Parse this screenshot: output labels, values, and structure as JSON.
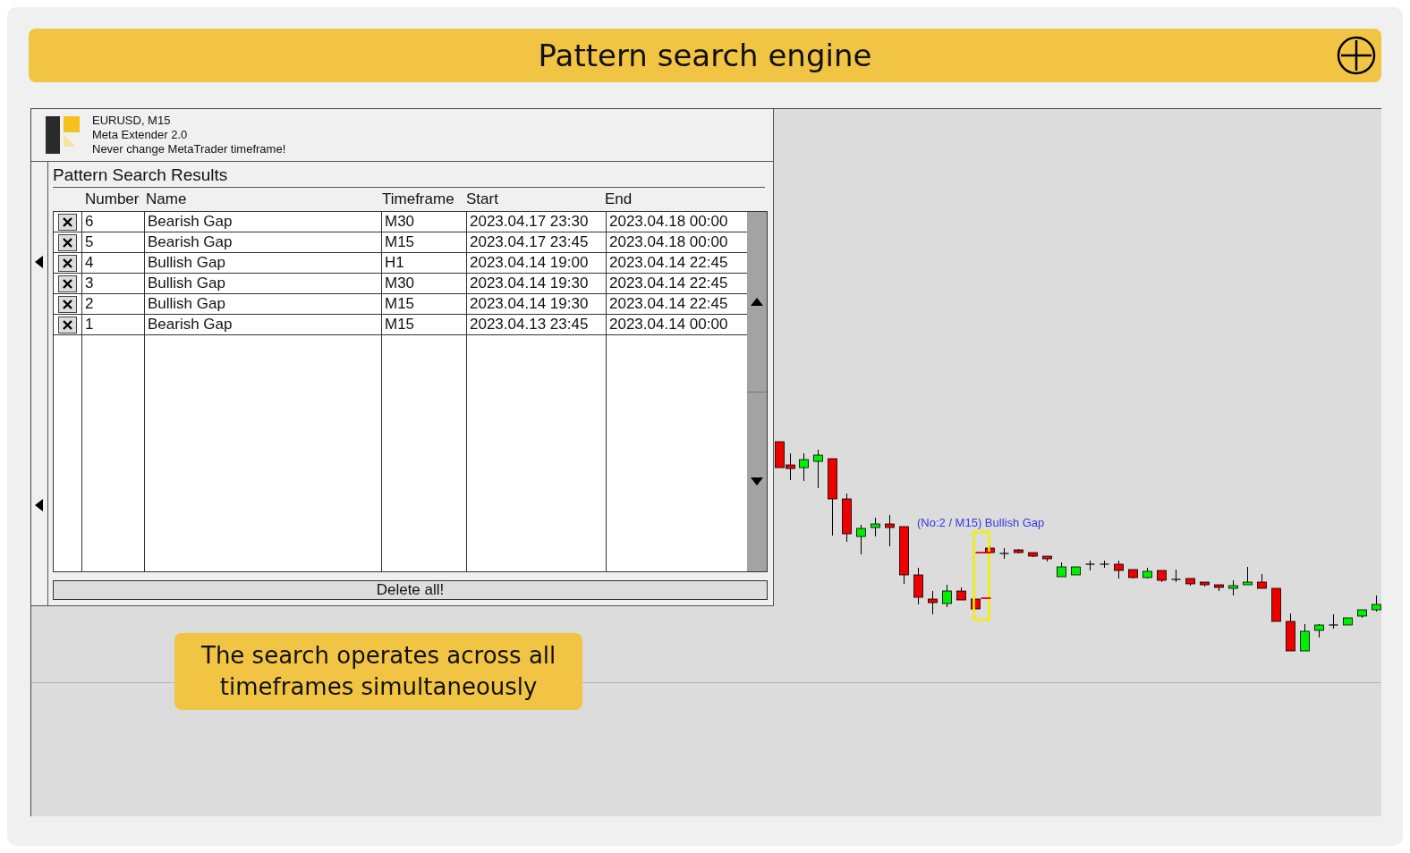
{
  "header": {
    "title": "Pattern search engine"
  },
  "panel": {
    "symbol": "EURUSD, M15",
    "product": "Meta Extender 2.0",
    "warning": "Never change MetaTrader timeframe!",
    "title": "Pattern Search Results",
    "columns": [
      "Number",
      "Name",
      "Timeframe",
      "Start",
      "End"
    ],
    "rows": [
      {
        "number": "6",
        "name": "Bearish Gap",
        "timeframe": "M30",
        "start": "2023.04.17 23:30",
        "end": "2023.04.18 00:00"
      },
      {
        "number": "5",
        "name": "Bearish Gap",
        "timeframe": "M15",
        "start": "2023.04.17 23:45",
        "end": "2023.04.18 00:00"
      },
      {
        "number": "4",
        "name": "Bullish Gap",
        "timeframe": "H1",
        "start": "2023.04.14 19:00",
        "end": "2023.04.14 22:45"
      },
      {
        "number": "3",
        "name": "Bullish Gap",
        "timeframe": "M30",
        "start": "2023.04.14 19:30",
        "end": "2023.04.14 22:45"
      },
      {
        "number": "2",
        "name": "Bullish Gap",
        "timeframe": "M15",
        "start": "2023.04.14 19:30",
        "end": "2023.04.14 22:45"
      },
      {
        "number": "1",
        "name": "Bearish Gap",
        "timeframe": "M15",
        "start": "2023.04.13 23:45",
        "end": "2023.04.14 00:00"
      }
    ],
    "delete_button": "Delete all!"
  },
  "chart": {
    "annotation": "(No:2 / M15) Bullish Gap"
  },
  "callout": {
    "lines": [
      "The search operates across all",
      "timeframes simultaneously"
    ]
  }
}
